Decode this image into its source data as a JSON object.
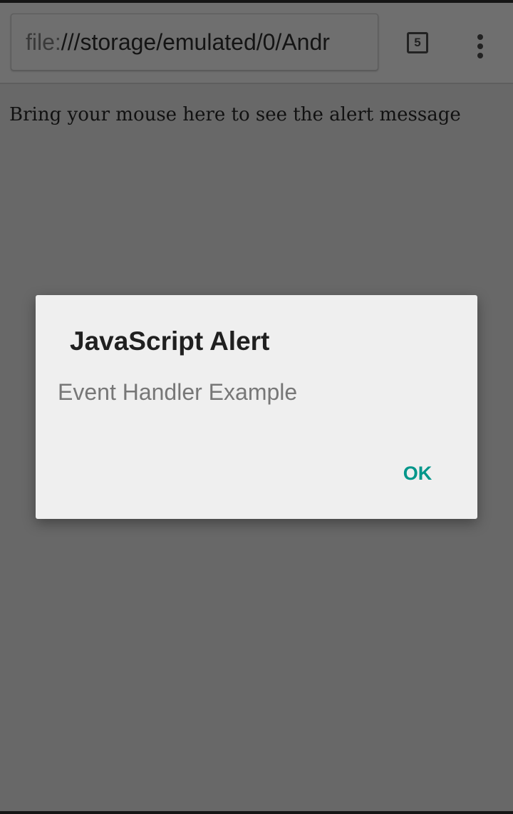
{
  "browser": {
    "url_scheme": "file:",
    "url_rest": "///storage/emulated/0/Andr",
    "tab_count": "5",
    "menu_icon": "overflow-menu-icon"
  },
  "page": {
    "text": "Bring your mouse here to see the alert message"
  },
  "dialog": {
    "title": "JavaScript Alert",
    "message": "Event Handler Example",
    "ok_label": "OK"
  },
  "colors": {
    "accent": "#00968a",
    "scrim": "#686868",
    "dialog_bg": "#efefef"
  }
}
